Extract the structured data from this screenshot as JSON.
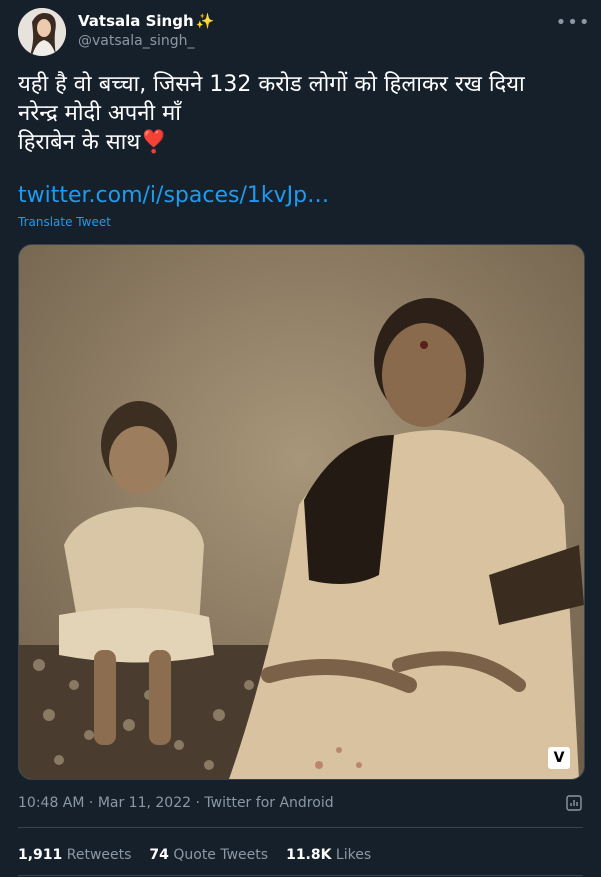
{
  "author": {
    "display_name": "Vatsala Singh",
    "badge_emoji": "✨",
    "handle": "@vatsala_singh_"
  },
  "tweet": {
    "text": "यही है वो बच्चा, जिसने 132 करोड लोगों को हिलाकर रख दिया\nनरेन्द्र मोदी अपनी माँ\nहिराबेन के साथ❣️",
    "link_text": "twitter.com/i/spaces/1kvJp…",
    "translate_label": "Translate Tweet",
    "media_watermark": "V"
  },
  "meta": {
    "time": "10:48 AM",
    "date": "Mar 11, 2022",
    "source": "Twitter for Android",
    "separator": "·"
  },
  "stats": {
    "retweets_count": "1,911",
    "retweets_label": "Retweets",
    "quotes_count": "74",
    "quotes_label": "Quote Tweets",
    "likes_count": "11.8K",
    "likes_label": "Likes"
  },
  "icons": {
    "more": "more-icon",
    "analytics": "analytics-icon"
  },
  "colors": {
    "background": "#15202b",
    "link": "#1d9bf0",
    "muted": "#8b98a5",
    "border": "#38444d"
  }
}
